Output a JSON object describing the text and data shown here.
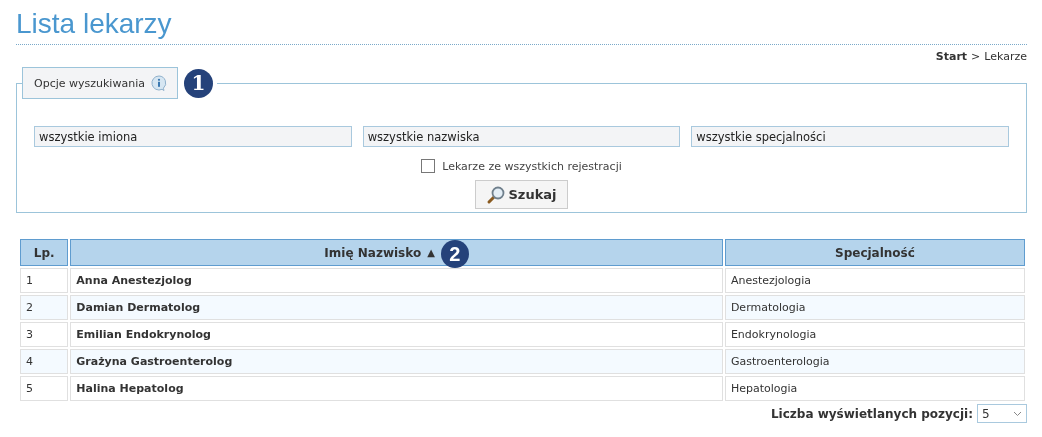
{
  "title": "Lista lekarzy",
  "breadcrumb": {
    "home": "Start",
    "separator": ">",
    "current": "Lekarze"
  },
  "search": {
    "legend": "Opcje wyszukiwania",
    "legend_badge": "1",
    "fields": [
      {
        "placeholder": "wszystkie imiona"
      },
      {
        "placeholder": "wszystkie nazwiska"
      },
      {
        "placeholder": "wszystkie specjalności"
      }
    ],
    "checkbox": {
      "label": "Lekarze ze wszystkich rejestracji",
      "checked": false
    },
    "button": "Szukaj"
  },
  "table": {
    "columns": [
      {
        "label": "Lp."
      },
      {
        "label": "Imię Nazwisko",
        "sort": "▲",
        "badge": "2"
      },
      {
        "label": "Specjalność"
      }
    ],
    "rows": [
      {
        "lp": "1",
        "name": "Anna Anestezjolog",
        "specialty": "Anestezjologia"
      },
      {
        "lp": "2",
        "name": "Damian Dermatolog",
        "specialty": "Dermatologia"
      },
      {
        "lp": "3",
        "name": "Emilian Endokrynolog",
        "specialty": "Endokrynologia"
      },
      {
        "lp": "4",
        "name": "Grażyna Gastroenterolog",
        "specialty": "Gastroenterologia"
      },
      {
        "lp": "5",
        "name": "Halina Hepatolog",
        "specialty": "Hepatologia"
      }
    ]
  },
  "page_size": {
    "label": "Liczba wyświetlanych pozycji:",
    "value": "5"
  }
}
